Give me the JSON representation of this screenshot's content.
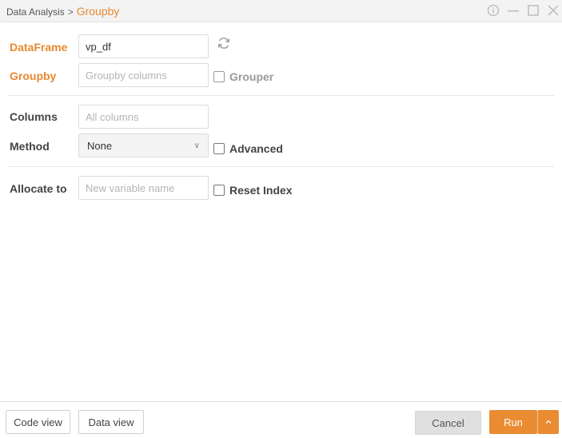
{
  "titlebar": {
    "parent": "Data Analysis",
    "separator": ">",
    "current": "Groupby"
  },
  "form": {
    "dataframe": {
      "label": "DataFrame",
      "value": "vp_df"
    },
    "groupby": {
      "label": "Groupby",
      "placeholder": "Groupby columns",
      "grouper_label": "Grouper"
    },
    "columns": {
      "label": "Columns",
      "placeholder": "All columns"
    },
    "method": {
      "label": "Method",
      "selected": "None",
      "advanced_label": "Advanced"
    },
    "allocate": {
      "label": "Allocate to",
      "placeholder": "New variable name",
      "reset_index_label": "Reset Index"
    }
  },
  "footer": {
    "code_view": "Code view",
    "data_view": "Data view",
    "cancel": "Cancel",
    "run": "Run"
  },
  "colors": {
    "accent": "#e8892e",
    "run_button": "#ea8c32"
  },
  "icons": {
    "info": "info-icon",
    "minimize": "minimize-icon",
    "maximize": "maximize-icon",
    "close": "close-icon",
    "refresh": "refresh-icon",
    "dropdown": "chevron-down-icon",
    "run_menu": "chevron-up-icon"
  }
}
